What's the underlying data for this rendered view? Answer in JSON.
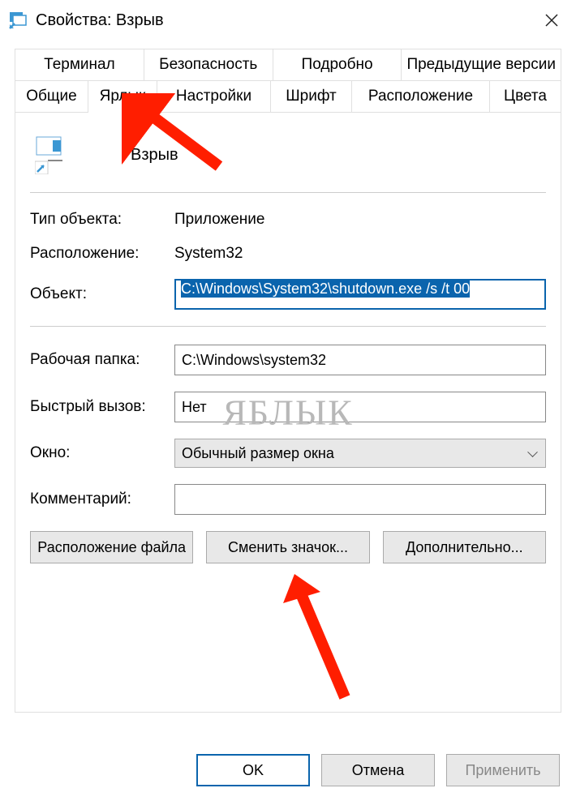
{
  "window": {
    "title": "Свойства: Взрыв"
  },
  "tabs_row1": [
    {
      "label": "Терминал"
    },
    {
      "label": "Безопасность"
    },
    {
      "label": "Подробно"
    },
    {
      "label": "Предыдущие версии"
    }
  ],
  "tabs_row2": [
    {
      "label": "Общие"
    },
    {
      "label": "Ярлык",
      "active": true
    },
    {
      "label": "Настройки"
    },
    {
      "label": "Шрифт"
    },
    {
      "label": "Расположение"
    },
    {
      "label": "Цвета"
    }
  ],
  "shortcut": {
    "name": "Взрыв",
    "type_label": "Тип объекта:",
    "type_value": "Приложение",
    "location_label": "Расположение:",
    "location_value": "System32",
    "target_label": "Объект:",
    "target_value": "C:\\Windows\\System32\\shutdown.exe /s /t 00",
    "startin_label": "Рабочая папка:",
    "startin_value": "C:\\Windows\\system32",
    "hotkey_label": "Быстрый вызов:",
    "hotkey_value": "Нет",
    "run_label": "Окно:",
    "run_value": "Обычный размер окна",
    "comment_label": "Комментарий:",
    "comment_value": ""
  },
  "buttons": {
    "open_location": "Расположение файла",
    "change_icon": "Сменить значок...",
    "advanced": "Дополнительно...",
    "ok": "OK",
    "cancel": "Отмена",
    "apply": "Применить"
  },
  "watermark": "ЯБЛЫК"
}
